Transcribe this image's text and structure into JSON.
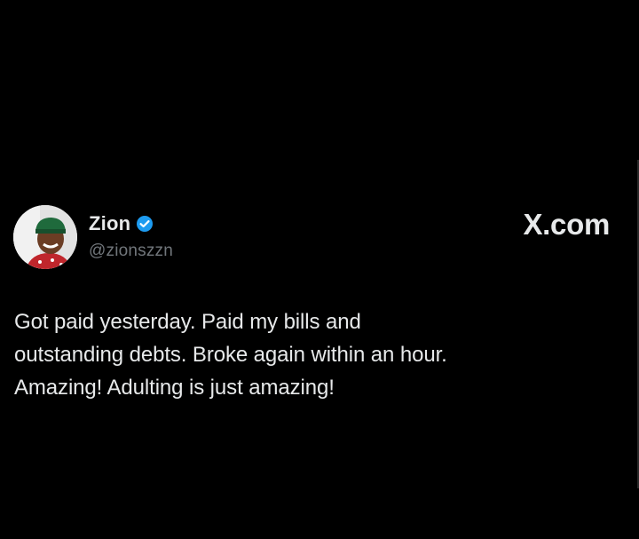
{
  "tweet": {
    "display_name": "Zion",
    "handle": "@zionszzn",
    "verified": true,
    "brand": "X.com",
    "text": "Got paid yesterday. Paid my bills and outstanding debts. Broke again within an hour. Amazing! Adulting is just amazing!"
  },
  "colors": {
    "background": "#000000",
    "text_primary": "#e7e9ea",
    "text_secondary": "#71767b",
    "verified_badge": "#1d9bf0"
  },
  "icons": {
    "avatar": "profile-photo",
    "verified": "verified-badge-icon"
  }
}
